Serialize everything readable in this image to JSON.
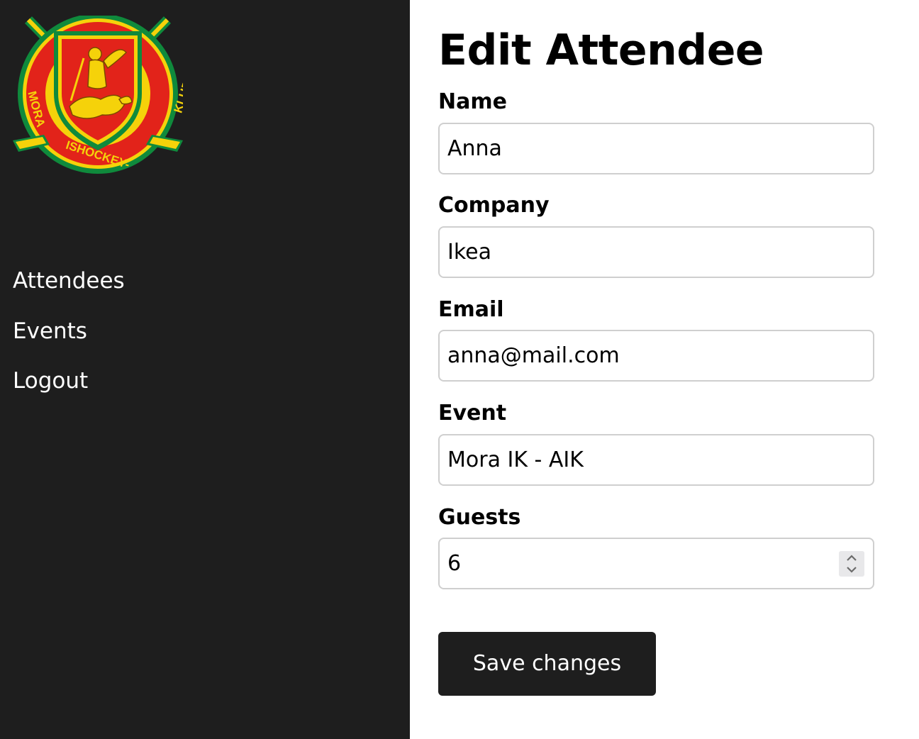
{
  "sidebar": {
    "logo": {
      "alt": "Mora Ishockey-Klubb logo",
      "text_left": "MORA",
      "text_bottom": "ISHOCKEY-",
      "text_right": "KLUBB"
    },
    "nav": [
      {
        "label": "Attendees",
        "icon": "none"
      },
      {
        "label": "Events",
        "icon": "none"
      },
      {
        "label": "Logout",
        "icon": "none"
      }
    ]
  },
  "main": {
    "title": "Edit Attendee",
    "fields": {
      "name": {
        "label": "Name",
        "value": "Anna"
      },
      "company": {
        "label": "Company",
        "value": "Ikea"
      },
      "email": {
        "label": "Email",
        "value": "anna@mail.com"
      },
      "event": {
        "label": "Event",
        "value": "Mora IK - AIK"
      },
      "guests": {
        "label": "Guests",
        "value": "6",
        "control": "number-stepper"
      }
    },
    "save_label": "Save changes"
  },
  "colors": {
    "sidebar_bg": "#1e1e1e",
    "page_bg": "#ffffff",
    "button_bg": "#1e1e1e",
    "input_border": "#cfcfcf",
    "logo_green": "#0f8a3c",
    "logo_red": "#e2231a",
    "logo_yellow": "#f5d20a"
  }
}
